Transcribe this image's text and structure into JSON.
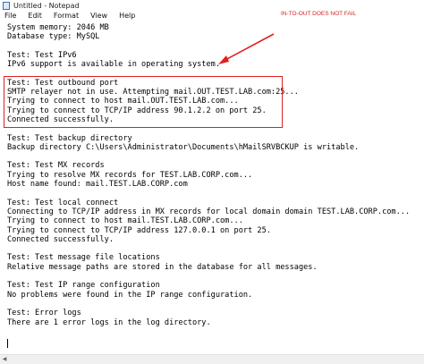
{
  "window": {
    "title": "Untitled - Notepad",
    "app_icon": "notepad-icon"
  },
  "menu": [
    {
      "label": "File"
    },
    {
      "label": "Edit"
    },
    {
      "label": "Format"
    },
    {
      "label": "View"
    },
    {
      "label": "Help"
    }
  ],
  "editor": {
    "lines": [
      "System memory: 2046 MB",
      "Database type: MySQL",
      "",
      "Test: Test IPv6",
      "IPv6 support is available in operating system.",
      "",
      "Test: Test outbound port",
      "SMTP relayer not in use. Attempting mail.OUT.TEST.LAB.com:25...",
      "Trying to connect to host mail.OUT.TEST.LAB.com...",
      "Trying to connect to TCP/IP address 90.1.2.2 on port 25.",
      "Connected successfully.",
      "",
      "Test: Test backup directory",
      "Backup directory C:\\Users\\Administrator\\Documents\\hMailSRVBCKUP is writable.",
      "",
      "Test: Test MX records",
      "Trying to resolve MX records for TEST.LAB.CORP.com...",
      "Host name found: mail.TEST.LAB.CORP.com",
      "",
      "Test: Test local connect",
      "Connecting to TCP/IP address in MX records for local domain domain TEST.LAB.CORP.com...",
      "Trying to connect to host mail.TEST.LAB.CORP.com...",
      "Trying to connect to TCP/IP address 127.0.0.1 on port 25.",
      "Connected successfully.",
      "",
      "Test: Test message file locations",
      "Relative message paths are stored in the database for all messages.",
      "",
      "Test: Test IP range configuration",
      "No problems were found in the IP range configuration.",
      "",
      "Test: Error logs",
      "There are 1 error logs in the log directory."
    ]
  },
  "annotation": {
    "text": "IN-TO-OUT DOES NOT FAIL",
    "color": "#e02020"
  }
}
